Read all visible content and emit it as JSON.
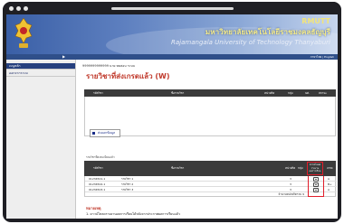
{
  "banner": {
    "short_name": "RMUTT",
    "thai_name": "มหาวิทยาลัยเทคโนโลยีราชมงคลธัญบุรี",
    "english_name": "Rajamangala University of Technology Thanyaburi"
  },
  "nav": {
    "right_text": "ภาษาไทย | English"
  },
  "sidebar": {
    "items": [
      {
        "label": "เมนูหลัก"
      },
      {
        "label": "ออกจากระบบ"
      }
    ]
  },
  "main": {
    "breadcrumb": "9999999999999 นาย ทดสอบ ระบบ",
    "title": "รายวิชาที่ส่งเกรดแล้ว (W)",
    "export_button_label": "ส่งออกข้อมูล",
    "table1": {
      "columns": [
        "รหัสวิชา",
        "ชื่อรายวิชา",
        "หน่วยกิต",
        "กลุ่ม",
        "นศ.",
        "สถานะ"
      ]
    },
    "table2": {
      "caption": "รายวิชาที่ลงทะเบียนแล้ว",
      "columns": [
        "รหัสวิชา",
        "ชื่อรายวิชา",
        "หน่วยกิต",
        "กลุ่ม",
        "เกรด"
      ],
      "focus_column": "ดาวน์โหลด\nรายงาน\nผลการเรียน",
      "rows": [
        {
          "code": "01234501-1",
          "name": "รายวิชา 1",
          "credit": "3",
          "grade": "A"
        },
        {
          "code": "01234502-1",
          "name": "รายวิชา 2",
          "credit": "3",
          "grade": "B+"
        },
        {
          "code": "01234503-1",
          "name": "รายวิชา 3",
          "credit": "3",
          "grade": "A"
        }
      ],
      "total_label": "จำนวนหน่วยกิตรวม 9"
    },
    "notes": {
      "title": "หมายเหตุ",
      "text": "1. ดาวน์โหลดรายงานผลการเรียนได้หลังจากประกาศผลการเรียนแล้ว"
    }
  },
  "icons": [
    "university-logo",
    "document-icon",
    "export-icon"
  ],
  "colors": {
    "banner": "#3a5fa6",
    "title": "#c0392b",
    "highlight": "#e11d2a",
    "header": "#3b3b3b"
  }
}
